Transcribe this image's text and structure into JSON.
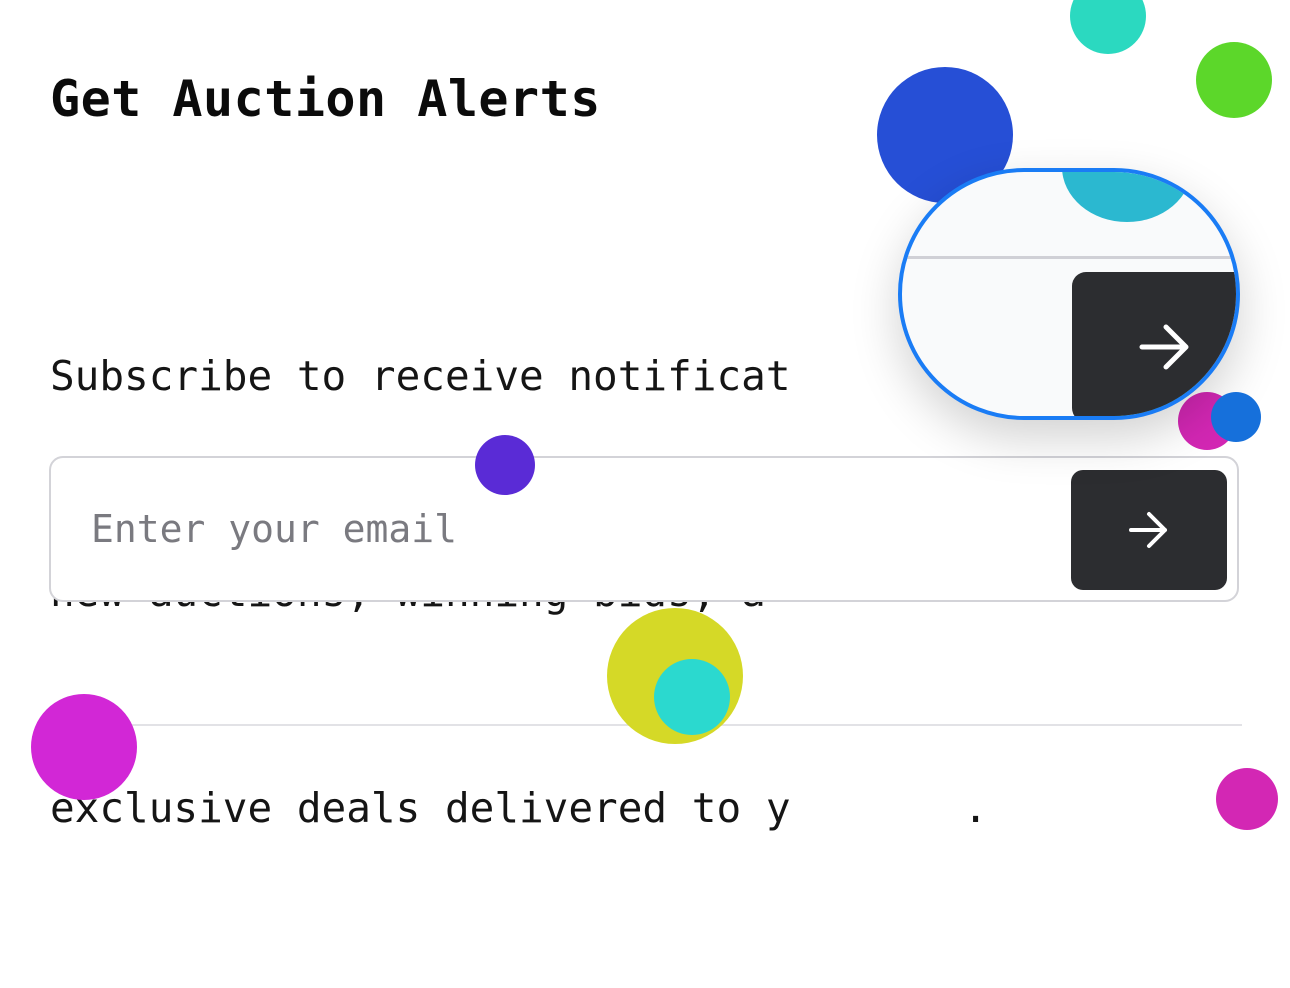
{
  "alerts": {
    "title": "Get Auction Alerts",
    "description_lines": [
      "Subscribe to receive notificat       t",
      "new auctions, winning bids, a",
      "exclusive deals delivered to y       ."
    ],
    "email_placeholder": "Enter your email",
    "submit_icon": "arrow-right-icon"
  },
  "magnifier": {
    "icon": "arrow-right-icon",
    "border_color": "#1a7cf5"
  },
  "colors": {
    "button_bg": "#2c2d30",
    "border": "#d3d3d8",
    "placeholder": "#7a7a80"
  },
  "decor_colors": [
    "#2bd9c0",
    "#5cd72a",
    "#264fd6",
    "#5a2bd6",
    "#d5d927",
    "#2bd9cf",
    "#d227d6",
    "#d327b4",
    "#1670db"
  ]
}
